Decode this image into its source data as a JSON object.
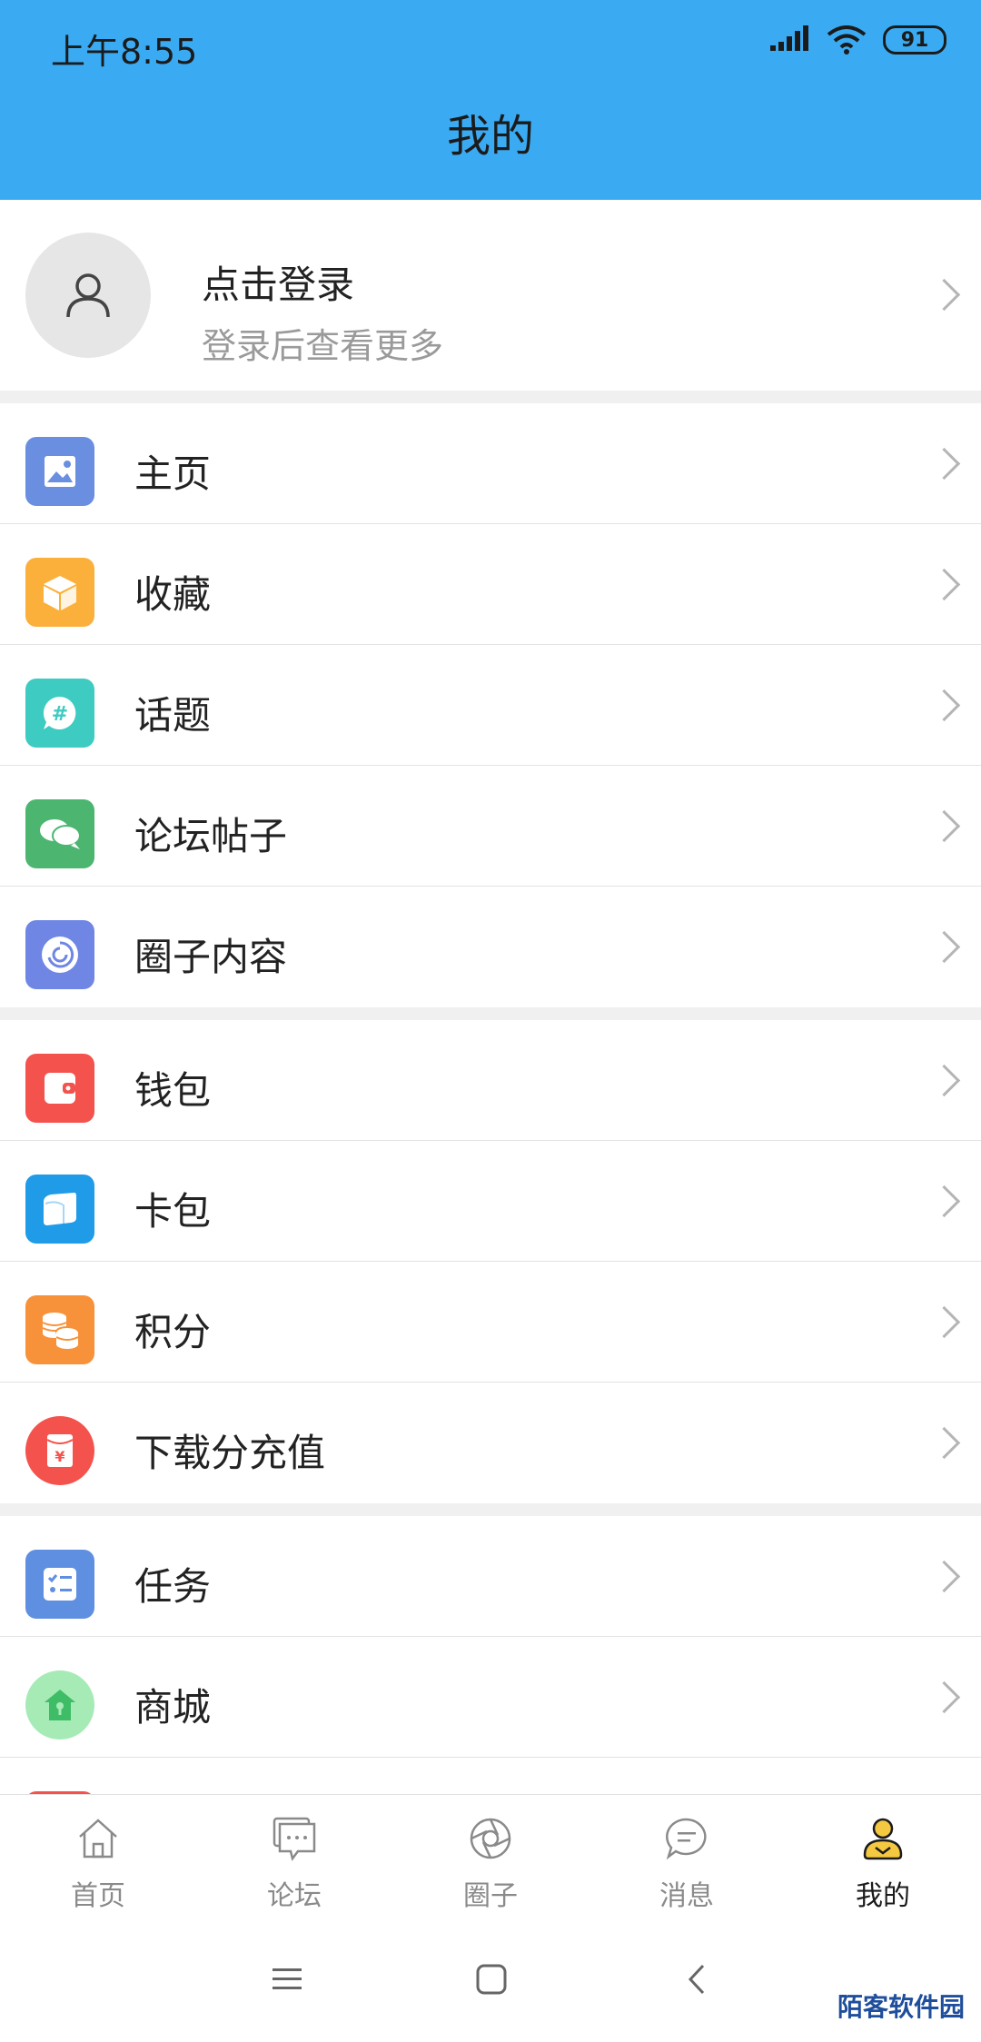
{
  "status": {
    "time": "上午8:55",
    "battery": "91"
  },
  "header": {
    "title": "我的"
  },
  "profile": {
    "title": "点击登录",
    "subtitle": "登录后查看更多"
  },
  "groups": [
    [
      {
        "label": "主页",
        "icon": "image-icon",
        "color": "#6a8ee0"
      },
      {
        "label": "收藏",
        "icon": "box-icon",
        "color": "#fbb03b"
      },
      {
        "label": "话题",
        "icon": "hashtag-bubble-icon",
        "color": "#3ecbc2"
      },
      {
        "label": "论坛帖子",
        "icon": "chat-bubbles-icon",
        "color": "#4cb671"
      },
      {
        "label": "圈子内容",
        "icon": "swirl-icon",
        "color": "#6f86e4"
      }
    ],
    [
      {
        "label": "钱包",
        "icon": "wallet-icon",
        "color": "#f4524d"
      },
      {
        "label": "卡包",
        "icon": "card-icon",
        "color": "#1f9be8"
      },
      {
        "label": "积分",
        "icon": "coins-icon",
        "color": "#f7923a"
      },
      {
        "label": "下载分充值",
        "icon": "red-envelope-icon",
        "color": "#f4524d"
      }
    ],
    [
      {
        "label": "任务",
        "icon": "checklist-icon",
        "color": "#5f8fe0"
      },
      {
        "label": "商城",
        "icon": "shop-house-icon",
        "color": "#a6ebb6"
      }
    ]
  ],
  "tabs": [
    {
      "label": "首页",
      "icon": "home-icon",
      "active": false
    },
    {
      "label": "论坛",
      "icon": "forum-icon",
      "active": false
    },
    {
      "label": "圈子",
      "icon": "circle-icon",
      "active": false
    },
    {
      "label": "消息",
      "icon": "message-icon",
      "active": false
    },
    {
      "label": "我的",
      "icon": "user-icon",
      "active": true
    }
  ],
  "watermark": "陌客软件园"
}
